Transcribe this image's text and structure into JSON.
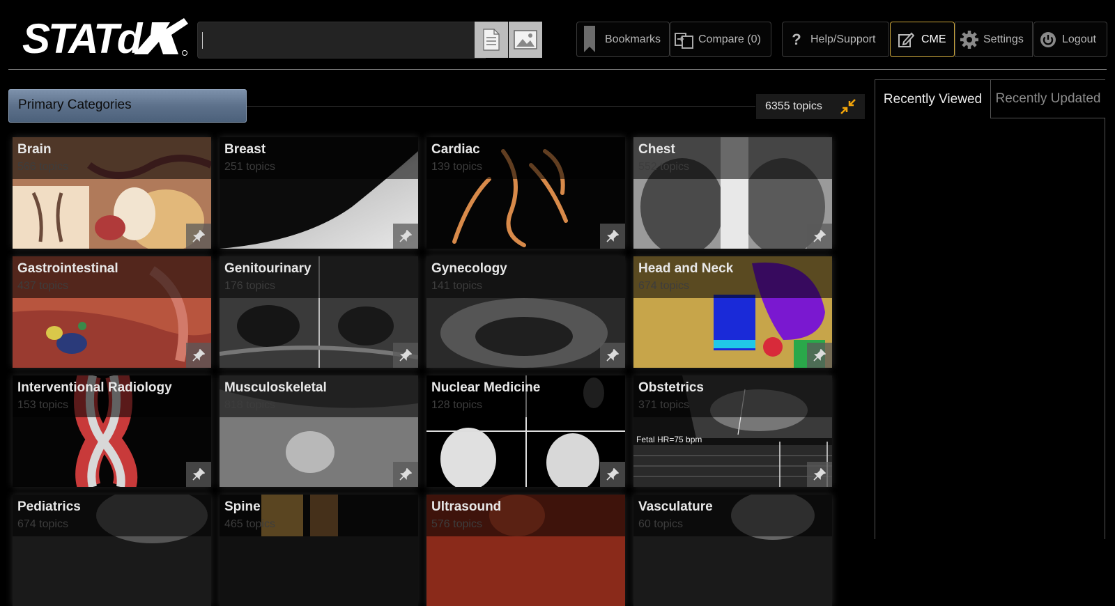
{
  "header": {
    "logo_text": "STATdx",
    "search": {
      "value": "",
      "placeholder": ""
    },
    "buttons": {
      "bookmarks": "Bookmarks",
      "compare": "Compare (0)",
      "help": "Help/Support",
      "cme": "CME",
      "settings": "Settings",
      "logout": "Logout"
    }
  },
  "primary": {
    "tab_label": "Primary Categories",
    "topics_count": "6355 topics"
  },
  "categories": [
    {
      "name": "Brain",
      "count": "566 topics"
    },
    {
      "name": "Breast",
      "count": "251 topics"
    },
    {
      "name": "Cardiac",
      "count": "139 topics"
    },
    {
      "name": "Chest",
      "count": "552 topics"
    },
    {
      "name": "Gastrointestinal",
      "count": "437 topics"
    },
    {
      "name": "Genitourinary",
      "count": "176 topics"
    },
    {
      "name": "Gynecology",
      "count": "141 topics"
    },
    {
      "name": "Head and Neck",
      "count": "674 topics"
    },
    {
      "name": "Interventional Radiology",
      "count": "153 topics"
    },
    {
      "name": "Musculoskeletal",
      "count": "818 topics"
    },
    {
      "name": "Nuclear Medicine",
      "count": "128 topics"
    },
    {
      "name": "Obstetrics",
      "count": "371 topics"
    },
    {
      "name": "Pediatrics",
      "count": "674 topics"
    },
    {
      "name": "Spine",
      "count": "465 topics"
    },
    {
      "name": "Ultrasound",
      "count": "576 topics"
    },
    {
      "name": "Vasculature",
      "count": "60 topics"
    }
  ],
  "image_overlays": {
    "obstetrics_caption": "Fetal HR=75 bpm"
  },
  "right_panel": {
    "tab_recent": "Recently Viewed",
    "tab_updated": "Recently Updated"
  },
  "colors": {
    "accent_cme": "#c9a43a",
    "tab_blue": "#5d718b",
    "pin_orange": "#f0a30a"
  }
}
